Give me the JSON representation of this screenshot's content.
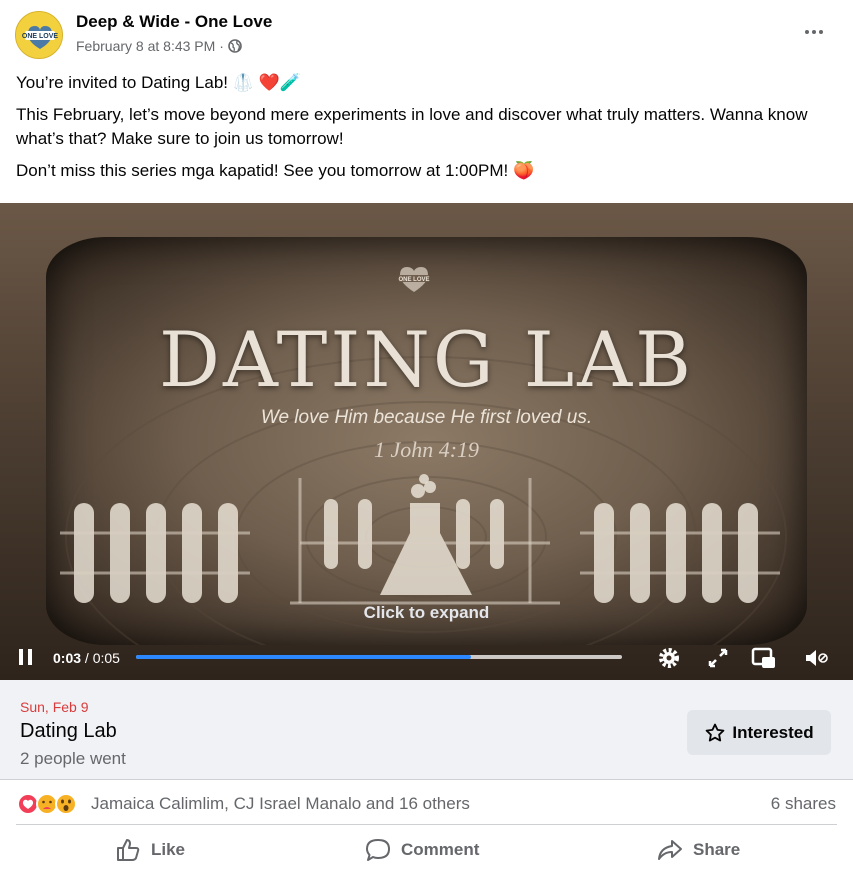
{
  "post": {
    "author": "Deep & Wide - One Love",
    "avatar_text": "ONE LOVE",
    "timestamp": "February 8 at 8:43 PM",
    "separator": "·",
    "privacy_icon": "globe-icon",
    "more_icon": "more-dots-icon",
    "paragraphs": [
      "You’re invited to Dating Lab! 🥼 ❤️🧪",
      "This February, let’s move beyond mere experiments in love and discover what truly matters. Wanna know what’s that? Make sure to join us tomorrow!",
      "Don’t miss this series mga kapatid! See you tomorrow at 1:00PM! 🍑"
    ]
  },
  "video": {
    "logo_text": "ONE LOVE",
    "title": "DATING LAB",
    "subtitle": "We love Him because He first loved us.",
    "verse": "1 John 4:19",
    "overlay": "Click to expand",
    "time_current": "0:03",
    "time_total": "/ 0:05",
    "progress": 0.69,
    "buffered": 1.0,
    "icons": [
      "pause-icon",
      "settings-icon",
      "fullscreen-icon",
      "miniplayer-icon",
      "mute-icon"
    ]
  },
  "event": {
    "date": "Sun, Feb 9",
    "title": "Dating Lab",
    "went": "2 people went",
    "interested_label": "Interested",
    "interested_icon": "star-icon"
  },
  "engagement": {
    "reaction_icons": [
      "love-icon",
      "care-icon",
      "wow-icon"
    ],
    "names": "Jamaica Calimlim, CJ Israel Manalo and 16 others",
    "shares": "6 shares"
  },
  "actions": {
    "like": "Like",
    "comment": "Comment",
    "share": "Share"
  },
  "colors": {
    "accent": "#2d88ff",
    "event_date": "#d93c3c",
    "secondary_text": "#65676b"
  }
}
